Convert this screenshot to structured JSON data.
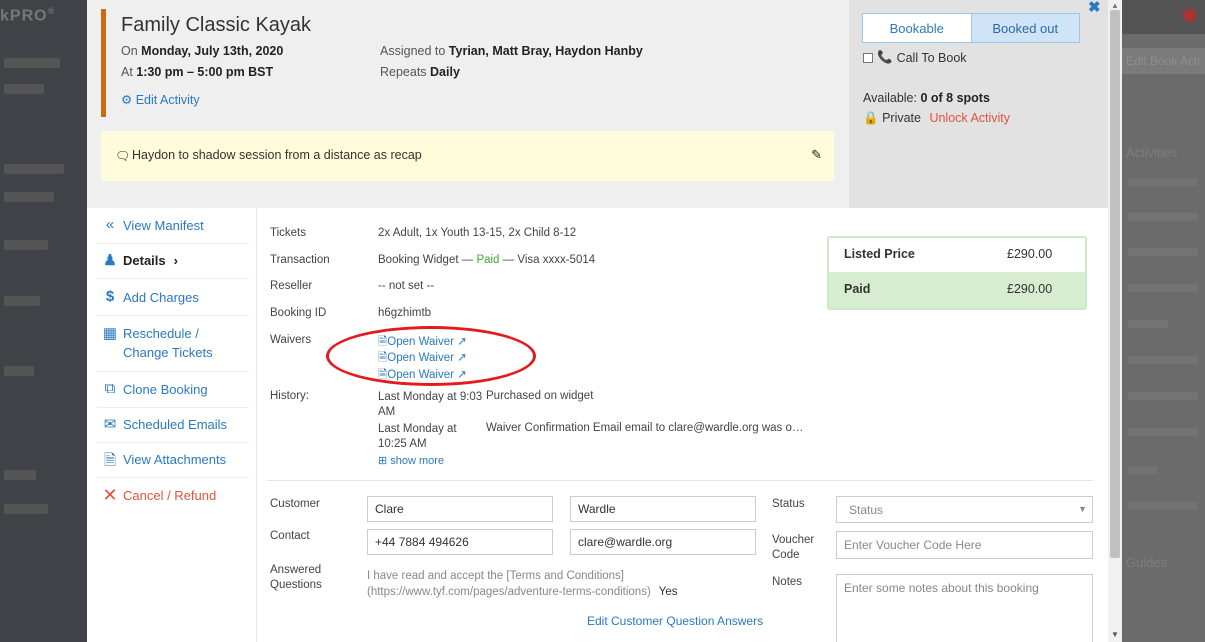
{
  "background": {
    "logo": "kPRO",
    "logo_sup": "®",
    "right_tab": "Edit Book Acti",
    "right_heading": "Activities",
    "right_footer": "Guides"
  },
  "activity": {
    "title": "Family Classic Kayak",
    "date_prefix": "On ",
    "date": "Monday, July 13th, 2020",
    "time_prefix": "At ",
    "time": "1:30 pm – 5:00 pm BST",
    "assigned_prefix": "Assigned to ",
    "assigned": "Tyrian, Matt Bray, Haydon Hanby",
    "repeats_prefix": "Repeats ",
    "repeats": "Daily",
    "edit_label": "Edit Activity",
    "note": "Haydon to shadow session from a distance as recap",
    "accent_color": "#cc6a10"
  },
  "status_panel": {
    "bookable_label": "Bookable",
    "booked_out_label": "Booked out",
    "call_to_book_label": "Call To Book",
    "available_prefix": "Available: ",
    "available": "0 of 8 spots",
    "private_label": "Private",
    "unlock_label": "Unlock Activity"
  },
  "nav": {
    "items": [
      {
        "label": "View Manifest",
        "icon": "double-chevron-left-icon"
      },
      {
        "label": "Details",
        "icon": "user-icon"
      },
      {
        "label": "Add Charges",
        "icon": "dollar-icon"
      },
      {
        "label": "Reschedule / Change Tickets",
        "icon": "calendar-icon"
      },
      {
        "label": "Clone Booking",
        "icon": "copy-icon"
      },
      {
        "label": "Scheduled Emails",
        "icon": "envelope-icon"
      },
      {
        "label": "View Attachments",
        "icon": "file-icon"
      },
      {
        "label": "Cancel / Refund",
        "icon": "x-icon"
      }
    ]
  },
  "details": {
    "tickets_label": "Tickets",
    "tickets": "2x Adult, 1x Youth 13-15, 2x Child 8-12",
    "transaction_label": "Transaction",
    "transaction_source": "Booking Widget — ",
    "transaction_status": "Paid",
    "transaction_card": " — Visa xxxx-5014",
    "reseller_label": "Reseller",
    "reseller": "-- not set --",
    "booking_id_label": "Booking ID",
    "booking_id": "h6gzhimtb",
    "waivers_label": "Waivers",
    "waivers": [
      "Open Waiver",
      "Open Waiver",
      "Open Waiver"
    ],
    "history_label": "History:",
    "history": [
      {
        "time_line1": "Last Monday at 9:03",
        "time_line2": "AM",
        "event": "Purchased on widget"
      },
      {
        "time_line1": "Last Monday at",
        "time_line2": "10:25 AM",
        "event": "Waiver Confirmation Email email to clare@wardle.org was o…"
      }
    ],
    "show_more": "show more"
  },
  "pricing": {
    "listed_label": "Listed Price",
    "listed_value": "£290.00",
    "paid_label": "Paid",
    "paid_value": "£290.00"
  },
  "customer": {
    "customer_label": "Customer",
    "first_name": "Clare",
    "last_name": "Wardle",
    "contact_label": "Contact",
    "phone": "+44 7884 494626",
    "email": "clare@wardle.org",
    "answered_label": "Answered Questions",
    "answered_text": "I have read and accept the [Terms and Conditions] (https://www.tyf.com/pages/adventure-terms-conditions)",
    "answered_value": "Yes",
    "edit_answers": "Edit Customer Question Answers",
    "status_label": "Status",
    "status_placeholder": "Status",
    "voucher_label": "Voucher Code",
    "voucher_placeholder": "Enter Voucher Code Here",
    "notes_label": "Notes",
    "notes_placeholder": "Enter some notes about this booking"
  }
}
